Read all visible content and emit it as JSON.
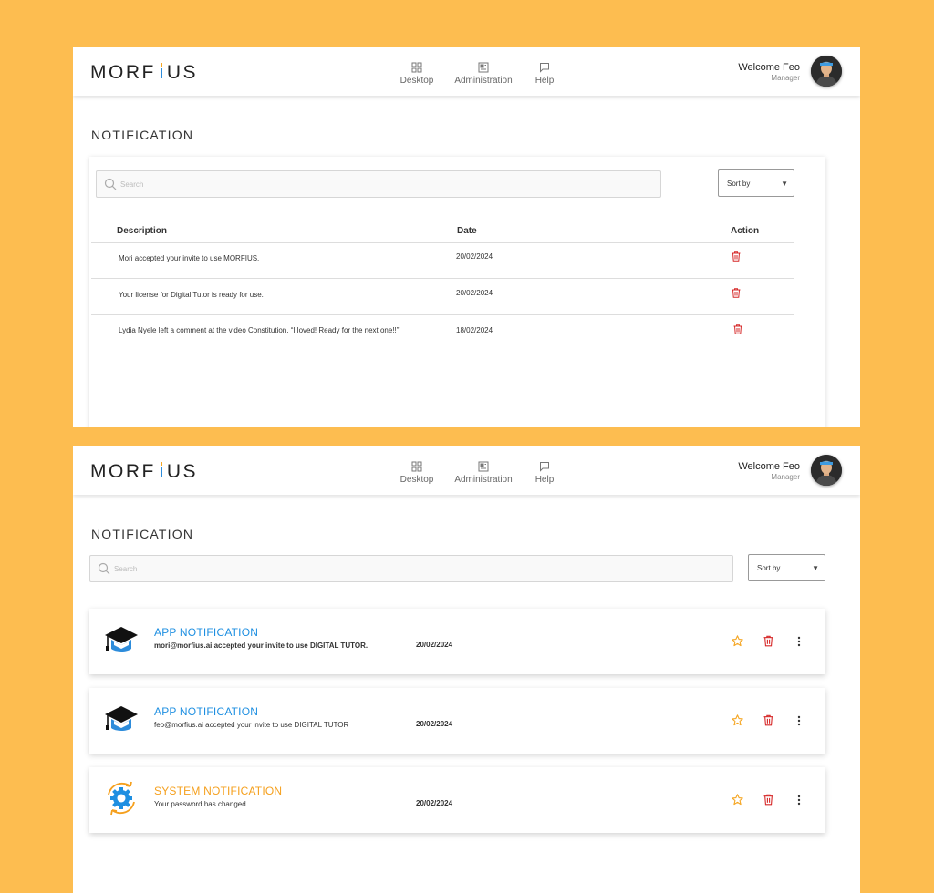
{
  "brand": {
    "logo_left": "MORF",
    "logo_right": "US"
  },
  "nav": [
    {
      "label": "Desktop"
    },
    {
      "label": "Administration"
    },
    {
      "label": "Help"
    }
  ],
  "user": {
    "welcome": "Welcome Feo",
    "role": "Manager"
  },
  "page_title": "NOTIFICATION",
  "search": {
    "placeholder": "Search"
  },
  "sort": {
    "label": "Sort by",
    "arrow": "▼"
  },
  "table": {
    "headers": {
      "description": "Description",
      "date": "Date",
      "action": "Action"
    },
    "rows": [
      {
        "description": "Mori accepted your invite to use MORFIUS.",
        "date": "20/02/2024"
      },
      {
        "description": "Your license for Digital Tutor is ready for use.",
        "date": "20/02/2024"
      },
      {
        "description": "Lydia Nyele left a comment at the video Constitution. “I loved! Ready for the next one!!”",
        "date": "18/02/2024"
      }
    ]
  },
  "notifications": [
    {
      "type": "app",
      "title": "APP NOTIFICATION",
      "message": "mori@morfius.ai accepted your invite to use DIGITAL TUTOR.",
      "date": "20/02/2024",
      "title_color": "#1E8FE1",
      "icon": "graduation-cap-icon"
    },
    {
      "type": "app",
      "title": "APP NOTIFICATION",
      "message": "feo@morfius.ai accepted your invite to use DIGITAL TUTOR",
      "date": "20/02/2024",
      "title_color": "#1E8FE1",
      "icon": "graduation-cap-icon"
    },
    {
      "type": "system",
      "title": "SYSTEM NOTIFICATION",
      "message": "Your password has changed",
      "date": "20/02/2024",
      "title_color": "#F5A01E",
      "icon": "gear-sync-icon"
    }
  ],
  "colors": {
    "background": "#FDBD50",
    "trash": "#D62828",
    "star": "#F5A623",
    "app_blue": "#1E8FE1",
    "system_orange": "#F5A01E"
  }
}
